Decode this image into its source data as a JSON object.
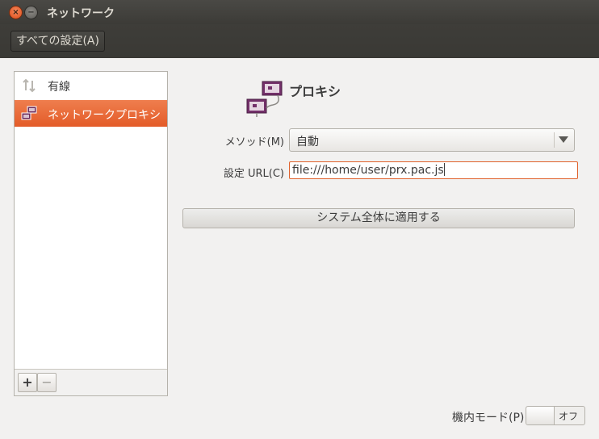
{
  "window": {
    "title": "ネットワーク"
  },
  "toolbar": {
    "all_settings": "すべての設定(A)"
  },
  "sidebar": {
    "items": [
      {
        "label": "有線",
        "icon": "wired-arrows-icon",
        "selected": false
      },
      {
        "label": "ネットワークプロキシ",
        "icon": "network-proxy-icon",
        "selected": true
      }
    ],
    "add_label": "+",
    "remove_label": "−"
  },
  "proxy": {
    "heading": "プロキシ",
    "method_label": "メソッド(M)",
    "method_value": "自動",
    "url_label": "設定 URL(C)",
    "url_value": "file:///home/user/prx.pac.js",
    "apply_label": "システム全体に適用する"
  },
  "airplane": {
    "label": "機内モード(P)",
    "state": "オフ"
  },
  "colors": {
    "accent": "#e35b28",
    "titlebar": "#3c3b37",
    "background": "#f2f1f0"
  }
}
